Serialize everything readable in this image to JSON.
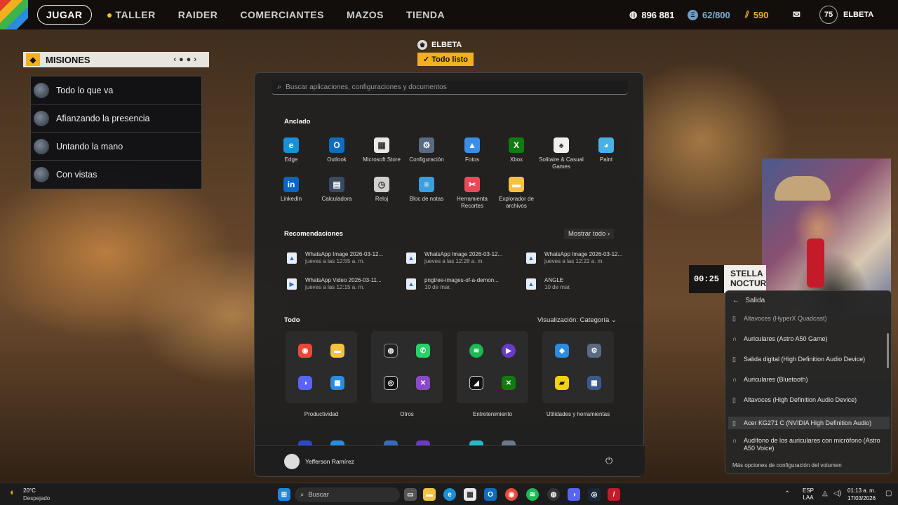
{
  "game": {
    "nav": [
      "JUGAR",
      "TALLER",
      "RAIDER",
      "COMERCIANTES",
      "MAZOS",
      "TIENDA"
    ],
    "resources": {
      "coins": "896 881",
      "tokens": "62/800",
      "keys": "590"
    },
    "level": "75",
    "player": "ELBETA",
    "missions": {
      "title": "MISIONES",
      "items": [
        "Todo lo que va",
        "Afianzando la presencia",
        "Untando la mano",
        "Con vistas"
      ]
    },
    "status": {
      "name": "ELBETA",
      "ready": "Todo listo"
    },
    "timer": "00:25",
    "stella": [
      "STELLA",
      "NOCTUR"
    ]
  },
  "start_menu": {
    "search_placeholder": "Buscar aplicaciones, configuraciones y documentos",
    "pinned_title": "Anclado",
    "pinned": [
      {
        "label": "Edge",
        "icon": "edge-icon",
        "color": "#1a8fd8",
        "glyph": "e"
      },
      {
        "label": "Outlook",
        "icon": "outlook-icon",
        "color": "#0f6cbd",
        "glyph": "O"
      },
      {
        "label": "Microsoft Store",
        "icon": "store-icon",
        "color": "#e8e8e8",
        "glyph": "▦"
      },
      {
        "label": "Configuración",
        "icon": "settings-icon",
        "color": "#5a6a80",
        "glyph": "⚙"
      },
      {
        "label": "Fotos",
        "icon": "photos-icon",
        "color": "#3a8ee8",
        "glyph": "▲"
      },
      {
        "label": "Xbox",
        "icon": "xbox-icon",
        "color": "#107c10",
        "glyph": "X"
      },
      {
        "label": "Solitaire & Casual Games",
        "icon": "solitaire-icon",
        "color": "#f0f0f0",
        "glyph": "♠"
      },
      {
        "label": "Paint",
        "icon": "paint-icon",
        "color": "#4ab0e8",
        "glyph": "◕"
      },
      {
        "label": "LinkedIn",
        "icon": "linkedin-icon",
        "color": "#0a66c2",
        "glyph": "in"
      },
      {
        "label": "Calculadora",
        "icon": "calculator-icon",
        "color": "#3a4a60",
        "glyph": "▤"
      },
      {
        "label": "Reloj",
        "icon": "clock-icon",
        "color": "#cfcfcf",
        "glyph": "◷"
      },
      {
        "label": "Bloc de notas",
        "icon": "notepad-icon",
        "color": "#3a9ee0",
        "glyph": "≡"
      },
      {
        "label": "Herramienta Recortes",
        "icon": "snipping-icon",
        "color": "#e84a5a",
        "glyph": "✂"
      },
      {
        "label": "Explorador de archivos",
        "icon": "folder-icon",
        "color": "#f2c240",
        "glyph": "▬"
      }
    ],
    "recommended_title": "Recomendaciones",
    "show_all": "Mostrar todo",
    "recommended": [
      {
        "name": "WhatsApp Image 2026-03-12...",
        "time": "jueves a las 12:55 a. m."
      },
      {
        "name": "WhatsApp Image 2026-03-12...",
        "time": "jueves a las 12:28 a. m."
      },
      {
        "name": "WhatsApp Image 2026-03-12...",
        "time": "jueves a las 12:22 a. m."
      },
      {
        "name": "WhatsApp Video 2026-03-11...",
        "time": "jueves a las 12:15 a. m."
      },
      {
        "name": "pngtree-images-of-a-demon...",
        "time": "10 de mar."
      },
      {
        "name": "ANGLE",
        "time": "10 de mar."
      }
    ],
    "all_title": "Todo",
    "view_label": "Visualización: Categoría",
    "groups": [
      "Productividad",
      "Otros",
      "Entretenimiento",
      "Utilidades y herramientas"
    ],
    "user": "Yefferson Ramírez"
  },
  "sound_panel": {
    "title": "Salida",
    "items": [
      "Altavoces (HyperX Quadcast)",
      "Auriculares (Astro A50 Game)",
      "Salida digital (High Definition Audio Device)",
      "Auriculares (Bluetooth)",
      "Altavoces (High Definition Audio Device)",
      "Acer KG271 C (NVIDIA High Definition Audio)",
      "Audífono de los auriculares con micrófono (Astro A50 Voice)"
    ],
    "more": "Más opciones de configuración del volumen"
  },
  "taskbar": {
    "weather_temp": "20°C",
    "weather_desc": "Despejado",
    "search": "Buscar",
    "lang1": "ESP",
    "lang2": "LAA",
    "time": "01:13 a. m.",
    "date": "17/03/2026"
  }
}
